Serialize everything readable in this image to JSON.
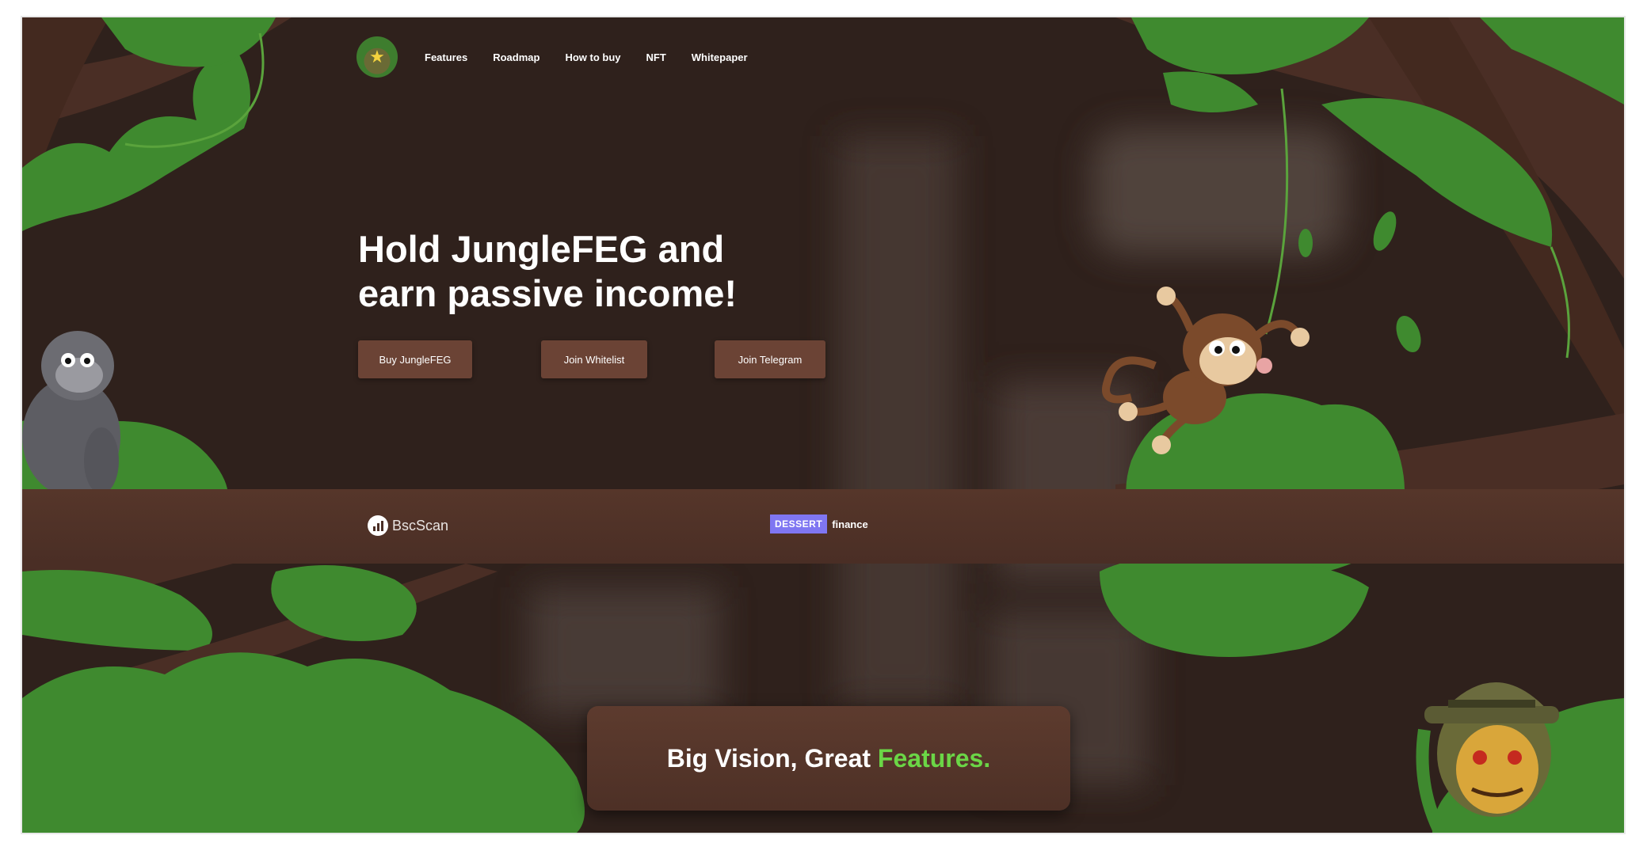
{
  "nav": {
    "links": [
      "Features",
      "Roadmap",
      "How to buy",
      "NFT",
      "Whitepaper"
    ]
  },
  "hero": {
    "title": "Hold JungleFEG and earn passive income!",
    "buttons": [
      "Buy JungleFEG",
      "Join Whitelist",
      "Join Telegram"
    ]
  },
  "partners": {
    "bscscan": "BscScan",
    "dessert_badge": "DESSERT",
    "dessert_suffix": "finance"
  },
  "features_section": {
    "heading_main": "Big Vision, Great",
    "heading_accent": "Features."
  },
  "colors": {
    "background": "#2f211c",
    "button_bg": "#6b4335",
    "accent_green": "#6bd646",
    "dessert_purple": "#7f76f2"
  },
  "icons": [
    "logo-mascot-icon",
    "bscscan-icon",
    "gorilla-icon",
    "monkey-icon",
    "mascot-hat-icon"
  ]
}
